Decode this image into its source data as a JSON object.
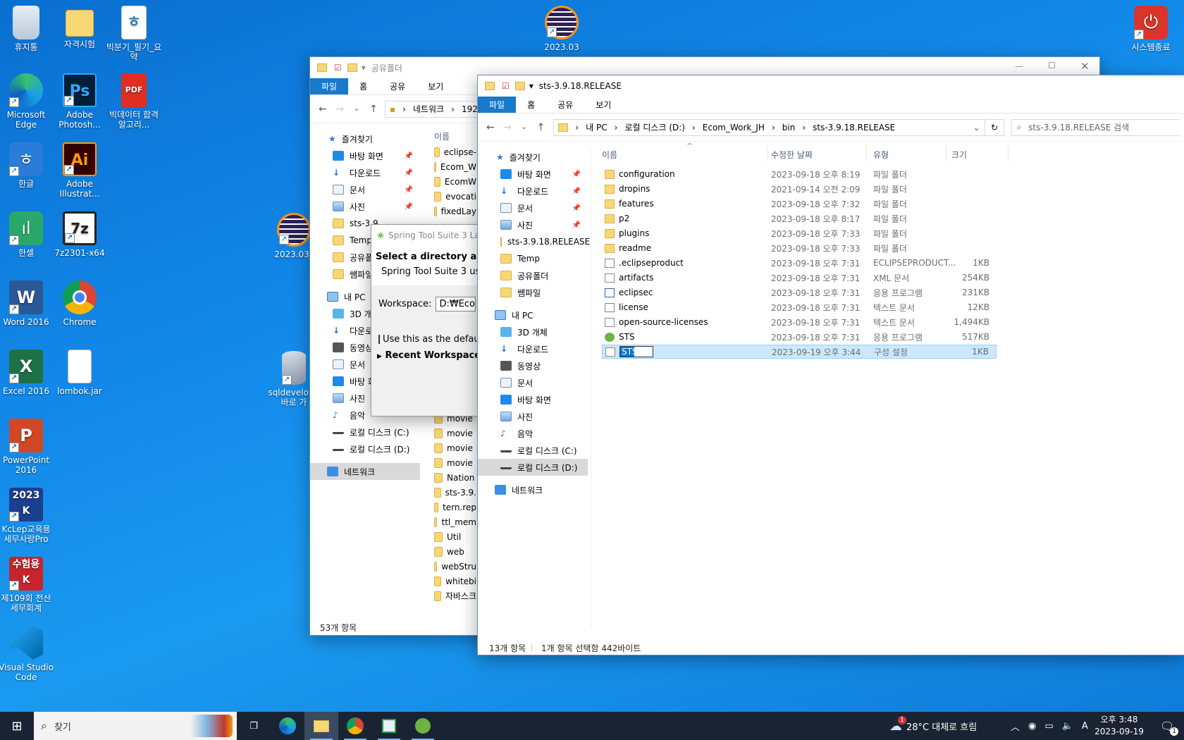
{
  "desktop": {
    "icons": [
      {
        "label": "휴지통",
        "icon": "recycle-bin-icon"
      },
      {
        "label": "자격시험",
        "icon": "folder-icon"
      },
      {
        "label": "빅분기_필기_요약",
        "icon": "hwp-document-icon"
      },
      {
        "label": "Microsoft Edge",
        "icon": "edge-icon"
      },
      {
        "label": "Adobe Photosh...",
        "icon": "photoshop-icon"
      },
      {
        "label": "빅데이터 합격 알고리...",
        "icon": "pdf-icon"
      },
      {
        "label": "한글",
        "icon": "hangul-icon"
      },
      {
        "label": "Adobe Illustrat...",
        "icon": "illustrator-icon"
      },
      {
        "label": "한셀",
        "icon": "hancell-icon"
      },
      {
        "label": "7z2301-x64",
        "icon": "7zip-icon"
      },
      {
        "label": "Word 2016",
        "icon": "word-icon"
      },
      {
        "label": "Chrome",
        "icon": "chrome-icon"
      },
      {
        "label": "Excel 2016",
        "icon": "excel-icon"
      },
      {
        "label": "lombok.jar",
        "icon": "jar-file-icon"
      },
      {
        "label": "PowerPoint 2016",
        "icon": "powerpoint-icon"
      },
      {
        "label": "KcLep교육용세무사랑Pro",
        "icon": "kclep-icon"
      },
      {
        "label": "제109회 전산 세무회계",
        "icon": "exam-icon"
      },
      {
        "label": "Visual Studio Code",
        "icon": "vscode-icon"
      },
      {
        "label": "2023.03",
        "icon": "eclipse-icon"
      },
      {
        "label": "2023.03_",
        "icon": "eclipse-icon"
      },
      {
        "label": "sqldevelop - 바로 가",
        "icon": "sqldeveloper-icon"
      },
      {
        "label": "시스템종료",
        "icon": "shutdown-icon"
      }
    ]
  },
  "back_window": {
    "title": "공유폴더",
    "ribbon": [
      "파일",
      "홈",
      "공유",
      "보기"
    ],
    "address": [
      "네트워크",
      "192"
    ],
    "nav": [
      {
        "label": "즐겨찾기",
        "icon": "star-icon"
      },
      {
        "label": "바탕 화면",
        "pinned": true
      },
      {
        "label": "다운로드",
        "pinned": true
      },
      {
        "label": "문서",
        "pinned": true
      },
      {
        "label": "사진",
        "pinned": true
      },
      {
        "label": "sts-3.9"
      },
      {
        "label": "Temp"
      },
      {
        "label": "공유폴"
      },
      {
        "label": "쌤파일"
      },
      {
        "label": "내 PC"
      },
      {
        "label": "3D 개"
      },
      {
        "label": "다운로"
      },
      {
        "label": "동영상"
      },
      {
        "label": "문서"
      },
      {
        "label": "바탕 화"
      },
      {
        "label": "사진"
      },
      {
        "label": "음악"
      },
      {
        "label": "로컬 디스크 (C:)"
      },
      {
        "label": "로컬 디스크 (D:)"
      },
      {
        "label": "네트워크"
      }
    ],
    "column_header": "이름",
    "files": [
      "eclipse-",
      "Ecom_W",
      "EcomW",
      "evocati",
      "fixedLay",
      "",
      "",
      "",
      "",
      "",
      "",
      "",
      "",
      "",
      "",
      "",
      "",
      "MOCK_",
      "movie",
      "movie",
      "movie",
      "movie",
      "Nation",
      "sts-3.9.",
      "tern.rep",
      "ttl_mem",
      "Util",
      "web",
      "webStru",
      "whitebi",
      "자바스크"
    ],
    "status": "53개 항목"
  },
  "dialog": {
    "title": "Spring Tool Suite 3 La",
    "heading": "Select a directory as wo",
    "subtext": "Spring Tool Suite 3 uses t",
    "workspace_label": "Workspace:",
    "workspace_value": "D:₩Ecom_W",
    "checkbox_label": "Use this as the default a",
    "recent_label": "Recent Workspaces"
  },
  "front_window": {
    "title": "sts-3.9.18.RELEASE",
    "ribbon": [
      "파일",
      "홈",
      "공유",
      "보기"
    ],
    "address": [
      "내 PC",
      "로컬 디스크 (D:)",
      "Ecom_Work_JH",
      "bin",
      "sts-3.9.18.RELEASE"
    ],
    "search_placeholder": "sts-3.9.18.RELEASE 검색",
    "nav": [
      {
        "label": "즐겨찾기"
      },
      {
        "label": "바탕 화면",
        "pinned": true
      },
      {
        "label": "다운로드",
        "pinned": true
      },
      {
        "label": "문서",
        "pinned": true
      },
      {
        "label": "사진",
        "pinned": true
      },
      {
        "label": "sts-3.9.18.RELEASE"
      },
      {
        "label": "Temp"
      },
      {
        "label": "공유폴더"
      },
      {
        "label": "쌤파일"
      },
      {
        "label": "내 PC"
      },
      {
        "label": "3D 개체"
      },
      {
        "label": "다운로드"
      },
      {
        "label": "동영상"
      },
      {
        "label": "문서"
      },
      {
        "label": "바탕 화면"
      },
      {
        "label": "사진"
      },
      {
        "label": "음악"
      },
      {
        "label": "로컬 디스크 (C:)"
      },
      {
        "label": "로컬 디스크 (D:)"
      },
      {
        "label": "네트워크"
      }
    ],
    "columns": {
      "name": "이름",
      "date": "수정한 날짜",
      "type": "유형",
      "size": "크기"
    },
    "rows": [
      {
        "name": "configuration",
        "date": "2023-09-18 오후 8:19",
        "type": "파일 폴더",
        "size": "",
        "icon": "folder-icon"
      },
      {
        "name": "dropins",
        "date": "2021-09-14 오전 2:09",
        "type": "파일 폴더",
        "size": "",
        "icon": "folder-icon"
      },
      {
        "name": "features",
        "date": "2023-09-18 오후 7:32",
        "type": "파일 폴더",
        "size": "",
        "icon": "folder-icon"
      },
      {
        "name": "p2",
        "date": "2023-09-18 오후 8:17",
        "type": "파일 폴더",
        "size": "",
        "icon": "folder-icon"
      },
      {
        "name": "plugins",
        "date": "2023-09-18 오후 7:33",
        "type": "파일 폴더",
        "size": "",
        "icon": "folder-icon"
      },
      {
        "name": "readme",
        "date": "2023-09-18 오후 7:33",
        "type": "파일 폴더",
        "size": "",
        "icon": "folder-icon"
      },
      {
        "name": ".eclipseproduct",
        "date": "2023-09-18 오후 7:31",
        "type": "ECLIPSEPRODUCT...",
        "size": "1KB",
        "icon": "file-icon"
      },
      {
        "name": "artifacts",
        "date": "2023-09-18 오후 7:31",
        "type": "XML 문서",
        "size": "254KB",
        "icon": "xml-file-icon"
      },
      {
        "name": "eclipsec",
        "date": "2023-09-18 오후 7:31",
        "type": "응용 프로그램",
        "size": "231KB",
        "icon": "app-icon"
      },
      {
        "name": "license",
        "date": "2023-09-18 오후 7:31",
        "type": "텍스트 문서",
        "size": "12KB",
        "icon": "text-file-icon"
      },
      {
        "name": "open-source-licenses",
        "date": "2023-09-18 오후 7:31",
        "type": "텍스트 문서",
        "size": "1,494KB",
        "icon": "text-file-icon"
      },
      {
        "name": "STS",
        "date": "2023-09-18 오후 7:31",
        "type": "응용 프로그램",
        "size": "517KB",
        "icon": "sts-icon"
      },
      {
        "name": "STS",
        "date": "2023-09-19 오후 3:44",
        "type": "구성 설정",
        "size": "1KB",
        "icon": "config-file-icon",
        "selected": true,
        "editing": true
      }
    ],
    "status_count": "13개 항목",
    "status_selected": "1개 항목 선택함 442바이트"
  },
  "taskbar": {
    "search_placeholder": "찾기",
    "weather": "28°C 대체로 흐림",
    "weather_badge": "1",
    "ime": "A",
    "time": "오후 3:48",
    "date": "2023-09-19",
    "notification_count": "1"
  },
  "colors": {
    "accent": "#1979ca",
    "selection": "#cce8ff",
    "folder": "#f8d775"
  }
}
